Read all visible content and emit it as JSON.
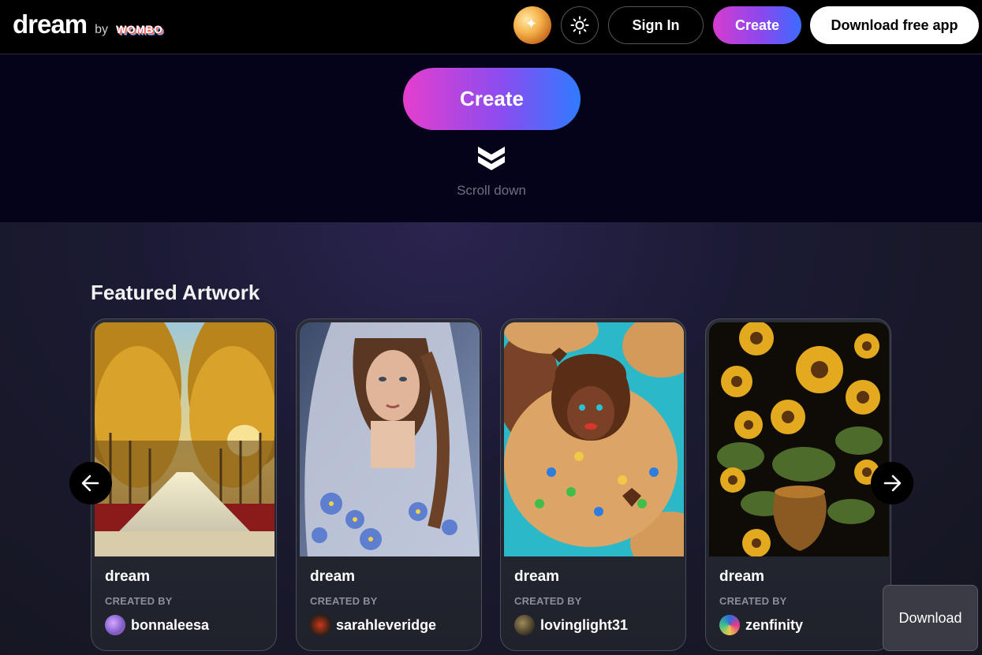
{
  "header": {
    "logo_word": "dream",
    "logo_by": "by",
    "logo_brand": "WOMBO",
    "signin_label": "Sign In",
    "create_label": "Create",
    "download_app_label": "Download free app"
  },
  "hero": {
    "create_label": "Create",
    "scroll_label": "Scroll down"
  },
  "featured": {
    "title": "Featured Artwork",
    "cards": [
      {
        "title": "dream",
        "created_by_label": "CREATED BY",
        "user": "bonnaleesa",
        "artwork": "golden-tree-path"
      },
      {
        "title": "dream",
        "created_by_label": "CREATED BY",
        "user": "sarahleveridge",
        "artwork": "veiled-woman-portrait"
      },
      {
        "title": "dream",
        "created_by_label": "CREATED BY",
        "user": "lovinglight31",
        "artwork": "cookie-face"
      },
      {
        "title": "dream",
        "created_by_label": "CREATED BY",
        "user": "zenfinity",
        "artwork": "sunflower-vase"
      }
    ]
  },
  "floating": {
    "download_label": "Download"
  },
  "colors": {
    "gradient_start": "#e53ecd",
    "gradient_end": "#2f7bff",
    "background": "#07061a"
  },
  "icons": [
    "sun-icon",
    "chevron-double-down-icon",
    "arrow-left-icon",
    "arrow-right-icon"
  ]
}
